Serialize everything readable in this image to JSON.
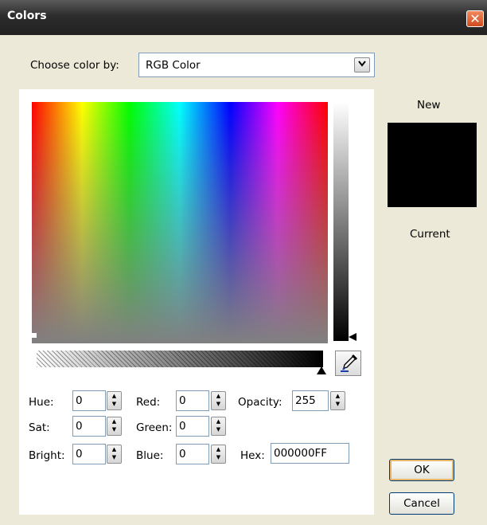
{
  "window": {
    "title": "Colors",
    "close_glyph": "✕"
  },
  "choose": {
    "label": "Choose color by:",
    "selected": "RGB Color",
    "arrow_icon": "chevron-down-icon"
  },
  "fields": {
    "hue": {
      "label": "Hue:",
      "value": "0"
    },
    "sat": {
      "label": "Sat:",
      "value": "0"
    },
    "bright": {
      "label": "Bright:",
      "value": "0"
    },
    "red": {
      "label": "Red:",
      "value": "0"
    },
    "green": {
      "label": "Green:",
      "value": "0"
    },
    "blue": {
      "label": "Blue:",
      "value": "0"
    },
    "opacity": {
      "label": "Opacity:",
      "value": "255"
    },
    "hex": {
      "label": "Hex:",
      "value": "000000FF"
    }
  },
  "preview": {
    "new_label": "New",
    "current_label": "Current",
    "new_color": "#000000"
  },
  "buttons": {
    "ok": "OK",
    "cancel": "Cancel"
  },
  "icons": {
    "eyedropper": "eyedropper-icon",
    "close": "close-icon"
  }
}
